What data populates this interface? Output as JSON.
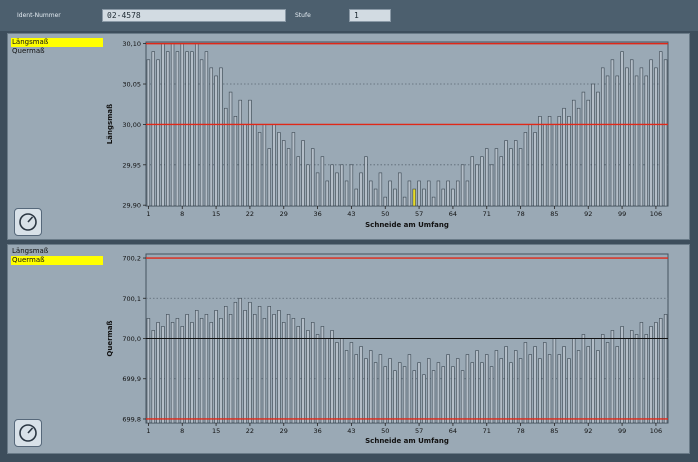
{
  "header": {
    "ident_label": "Ident-Nummer",
    "ident_value": "02-4578",
    "stufe_label": "Stufe",
    "stufe_value": "1"
  },
  "legend": {
    "item1": "Längsmaß",
    "item2": "Quermaß"
  },
  "colors": {
    "bar_fill": "#b4bec8",
    "bar_stroke": "#3a4650",
    "plot_bg": "#9aa9b5",
    "limit_line": "#e02818",
    "highlight_bar": "#e8dc28",
    "active_legend": "#ffff00"
  },
  "chart_data": [
    {
      "type": "bar",
      "xlabel": "Schneide am Umfang",
      "ylabel": "Längsmaß",
      "ylim": [
        29.899,
        30.102
      ],
      "yticks": [
        "29,90",
        "29,95",
        "30,00",
        "30,05",
        "30,10"
      ],
      "ytick_values": [
        29.9,
        29.95,
        30.0,
        30.05,
        30.1
      ],
      "xticks": [
        "1",
        "8",
        "15",
        "22",
        "29",
        "36",
        "43",
        "50",
        "57",
        "64",
        "71",
        "78",
        "85",
        "92",
        "99",
        "106"
      ],
      "limit_lines": [
        30.1,
        30.0
      ],
      "center_line": null,
      "dotted_lines": [
        30.05,
        29.95
      ],
      "highlight_index": 55,
      "x": [
        1,
        2,
        3,
        4,
        5,
        6,
        7,
        8,
        9,
        10,
        11,
        12,
        13,
        14,
        15,
        16,
        17,
        18,
        19,
        20,
        21,
        22,
        23,
        24,
        25,
        26,
        27,
        28,
        29,
        30,
        31,
        32,
        33,
        34,
        35,
        36,
        37,
        38,
        39,
        40,
        41,
        42,
        43,
        44,
        45,
        46,
        47,
        48,
        49,
        50,
        51,
        52,
        53,
        54,
        55,
        56,
        57,
        58,
        59,
        60,
        61,
        62,
        63,
        64,
        65,
        66,
        67,
        68,
        69,
        70,
        71,
        72,
        73,
        74,
        75,
        76,
        77,
        78,
        79,
        80,
        81,
        82,
        83,
        84,
        85,
        86,
        87,
        88,
        89,
        90,
        91,
        92,
        93,
        94,
        95,
        96,
        97,
        98,
        99,
        100,
        101,
        102,
        103,
        104,
        105,
        106,
        107,
        108
      ],
      "values": [
        30.08,
        30.09,
        30.08,
        30.1,
        30.09,
        30.1,
        30.09,
        30.1,
        30.09,
        30.09,
        30.1,
        30.08,
        30.09,
        30.07,
        30.06,
        30.07,
        30.02,
        30.04,
        30.01,
        30.03,
        30.0,
        30.03,
        30.0,
        29.99,
        30.0,
        29.97,
        30.0,
        29.99,
        29.98,
        29.97,
        29.99,
        29.96,
        29.98,
        29.95,
        29.97,
        29.94,
        29.96,
        29.93,
        29.95,
        29.94,
        29.95,
        29.93,
        29.95,
        29.92,
        29.94,
        29.96,
        29.93,
        29.92,
        29.94,
        29.91,
        29.93,
        29.92,
        29.94,
        29.91,
        29.93,
        29.92,
        29.93,
        29.92,
        29.93,
        29.91,
        29.93,
        29.92,
        29.93,
        29.92,
        29.93,
        29.95,
        29.93,
        29.96,
        29.95,
        29.96,
        29.97,
        29.95,
        29.97,
        29.96,
        29.98,
        29.97,
        29.98,
        29.97,
        29.99,
        30.0,
        29.99,
        30.01,
        30.0,
        30.01,
        30.0,
        30.01,
        30.02,
        30.01,
        30.03,
        30.02,
        30.04,
        30.03,
        30.05,
        30.04,
        30.07,
        30.06,
        30.08,
        30.06,
        30.09,
        30.07,
        30.08,
        30.06,
        30.07,
        30.06,
        30.08,
        30.07,
        30.09,
        30.08
      ]
    },
    {
      "type": "bar",
      "xlabel": "Schneide am Umfang",
      "ylabel": "Quermaß",
      "ylim": [
        699.79,
        700.21
      ],
      "yticks": [
        "699,8",
        "699,9",
        "700,0",
        "700,1",
        "700,2"
      ],
      "ytick_values": [
        699.8,
        699.9,
        700.0,
        700.1,
        700.2
      ],
      "xticks": [
        "1",
        "8",
        "15",
        "22",
        "29",
        "36",
        "43",
        "50",
        "57",
        "64",
        "71",
        "78",
        "85",
        "92",
        "99",
        "106"
      ],
      "limit_lines": [
        700.2,
        699.8
      ],
      "center_line": 700.0,
      "dotted_lines": [
        700.1,
        699.9
      ],
      "highlight_index": null,
      "x": [
        1,
        2,
        3,
        4,
        5,
        6,
        7,
        8,
        9,
        10,
        11,
        12,
        13,
        14,
        15,
        16,
        17,
        18,
        19,
        20,
        21,
        22,
        23,
        24,
        25,
        26,
        27,
        28,
        29,
        30,
        31,
        32,
        33,
        34,
        35,
        36,
        37,
        38,
        39,
        40,
        41,
        42,
        43,
        44,
        45,
        46,
        47,
        48,
        49,
        50,
        51,
        52,
        53,
        54,
        55,
        56,
        57,
        58,
        59,
        60,
        61,
        62,
        63,
        64,
        65,
        66,
        67,
        68,
        69,
        70,
        71,
        72,
        73,
        74,
        75,
        76,
        77,
        78,
        79,
        80,
        81,
        82,
        83,
        84,
        85,
        86,
        87,
        88,
        89,
        90,
        91,
        92,
        93,
        94,
        95,
        96,
        97,
        98,
        99,
        100,
        101,
        102,
        103,
        104,
        105,
        106,
        107,
        108
      ],
      "values": [
        700.05,
        700.02,
        700.04,
        700.03,
        700.06,
        700.04,
        700.05,
        700.03,
        700.06,
        700.04,
        700.07,
        700.05,
        700.06,
        700.04,
        700.07,
        700.05,
        700.08,
        700.06,
        700.09,
        700.1,
        700.07,
        700.09,
        700.06,
        700.08,
        700.05,
        700.08,
        700.06,
        700.07,
        700.04,
        700.06,
        700.05,
        700.03,
        700.05,
        700.02,
        700.04,
        700.01,
        700.03,
        700.0,
        700.02,
        699.99,
        700.0,
        699.97,
        699.99,
        699.96,
        699.98,
        699.95,
        699.97,
        699.94,
        699.96,
        699.93,
        699.95,
        699.92,
        699.94,
        699.93,
        699.96,
        699.92,
        699.94,
        699.91,
        699.95,
        699.92,
        699.94,
        699.93,
        699.96,
        699.93,
        699.95,
        699.92,
        699.96,
        699.94,
        699.97,
        699.94,
        699.96,
        699.93,
        699.97,
        699.95,
        699.98,
        699.94,
        699.97,
        699.95,
        699.99,
        699.96,
        699.98,
        699.95,
        699.99,
        699.96,
        700.0,
        699.96,
        699.98,
        699.95,
        700.0,
        699.97,
        700.01,
        699.98,
        700.0,
        699.97,
        700.01,
        699.99,
        700.02,
        699.98,
        700.03,
        700.0,
        700.02,
        700.01,
        700.04,
        700.01,
        700.03,
        700.04,
        700.05,
        700.06
      ]
    }
  ]
}
